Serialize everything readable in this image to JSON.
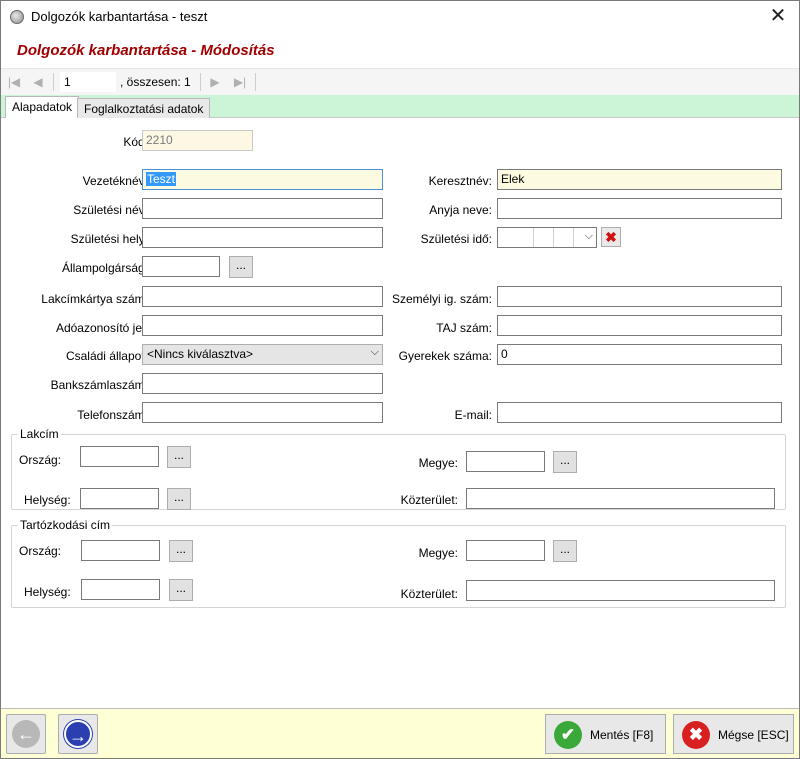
{
  "window": {
    "title": "Dolgozók karbantartása - teszt",
    "close_glyph": "✕"
  },
  "heading": "Dolgozók karbantartása - Módosítás",
  "navigator": {
    "position": "1",
    "total": ", összesen: 1",
    "first_glyph": "|◀",
    "prev_glyph": "◀",
    "next_glyph": "▶",
    "last_glyph": "▶|"
  },
  "tabs": [
    {
      "label": "Alapadatok",
      "active": true
    },
    {
      "label": "Foglalkoztatási adatok",
      "active": false
    }
  ],
  "form": {
    "kod": {
      "label": "Kód:",
      "value": "2210"
    },
    "vezeteknev": {
      "label": "Vezetéknév:",
      "value": "Teszt"
    },
    "keresztnev": {
      "label": "Keresztnév:",
      "value": "Elek"
    },
    "szuletesi_nev": {
      "label": "Születési név:",
      "value": ""
    },
    "anyja_neve": {
      "label": "Anyja neve:",
      "value": ""
    },
    "szuletesi_hely": {
      "label": "Születési hely:",
      "value": ""
    },
    "szuletesi_ido": {
      "label": "Születési idő:",
      "value": ""
    },
    "allampolgarsag": {
      "label": "Állampolgárság:",
      "value": ""
    },
    "lakcimkartya": {
      "label": "Lakcímkártya szám:",
      "value": ""
    },
    "szemelyi": {
      "label": "Személyi ig. szám:",
      "value": ""
    },
    "adoazonosito": {
      "label": "Adóazonosító jel:",
      "value": ""
    },
    "taj": {
      "label": "TAJ szám:",
      "value": ""
    },
    "csaladi_allapot": {
      "label": "Családi állapot:",
      "value": "<Nincs kiválasztva>"
    },
    "gyerekek": {
      "label": "Gyerekek száma:",
      "value": "0"
    },
    "bankszamla": {
      "label": "Bankszámlaszám:",
      "value": ""
    },
    "telefon": {
      "label": "Telefonszám:",
      "value": ""
    },
    "email": {
      "label": "E-mail:",
      "value": ""
    }
  },
  "lakcim": {
    "legend": "Lakcím",
    "orszag_label": "Ország:",
    "megye_label": "Megye:",
    "helyseg_label": "Helység:",
    "kozterulet_label": "Közterület:"
  },
  "tartozkodasi": {
    "legend": "Tartózkodási cím",
    "orszag_label": "Ország:",
    "megye_label": "Megye:",
    "helyseg_label": "Helység:",
    "kozterulet_label": "Közterület:"
  },
  "browse_label": "...",
  "dropdown_glyph": "⌵",
  "clear_glyph": "✖",
  "buttons": {
    "back_glyph": "←",
    "forward_glyph": "→",
    "save": "Mentés [F8]",
    "save_glyph": "✔",
    "cancel": "Mégse [ESC]",
    "cancel_glyph": "✖"
  },
  "colors": {
    "heading": "#a00000",
    "tabstrip": "#ccf5d8",
    "bottom_bar": "#ffffd6",
    "readonly_field": "#fcf8e3",
    "save_icon": "#3aa93a",
    "cancel_icon": "#d82020",
    "back_icon": "#b8b8b8",
    "forward_icon": "#2c3fb0"
  }
}
